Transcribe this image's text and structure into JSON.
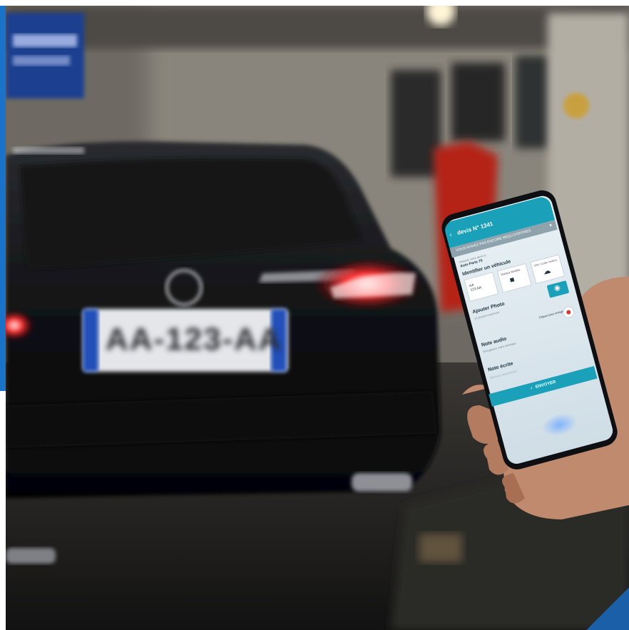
{
  "photo": {
    "license_plate": "AA-123-AA",
    "phone_app": {
      "header_title": "devis N° 1341",
      "banner": "VOUS N'AVEZ PAS ENCORE REÇU D'OFFRES",
      "garage_label": "Adresse votre devis à",
      "garage_name": "Auto Parts 75",
      "section_identify": "Identifier un véhicule",
      "option_plate": "AA\n123 AA",
      "option_brand": "Marque Modèle",
      "option_vin": "VIN / Code moteur",
      "section_photo": "Ajouter Photo",
      "photo_hint": "10 photos maximum",
      "section_audio": "Note audio",
      "audio_hint": "Enregistrez votre message",
      "audio_record": "Cliquer pour enregistrer",
      "section_written": "Note écrite",
      "written_placeholder": "Décrivez votre besoin",
      "send_button": "ENVOYER"
    }
  },
  "colors": {
    "accent": "#1a73c8",
    "app_teal": "#1aa0b8",
    "tail_light": "#ff2a2a"
  }
}
